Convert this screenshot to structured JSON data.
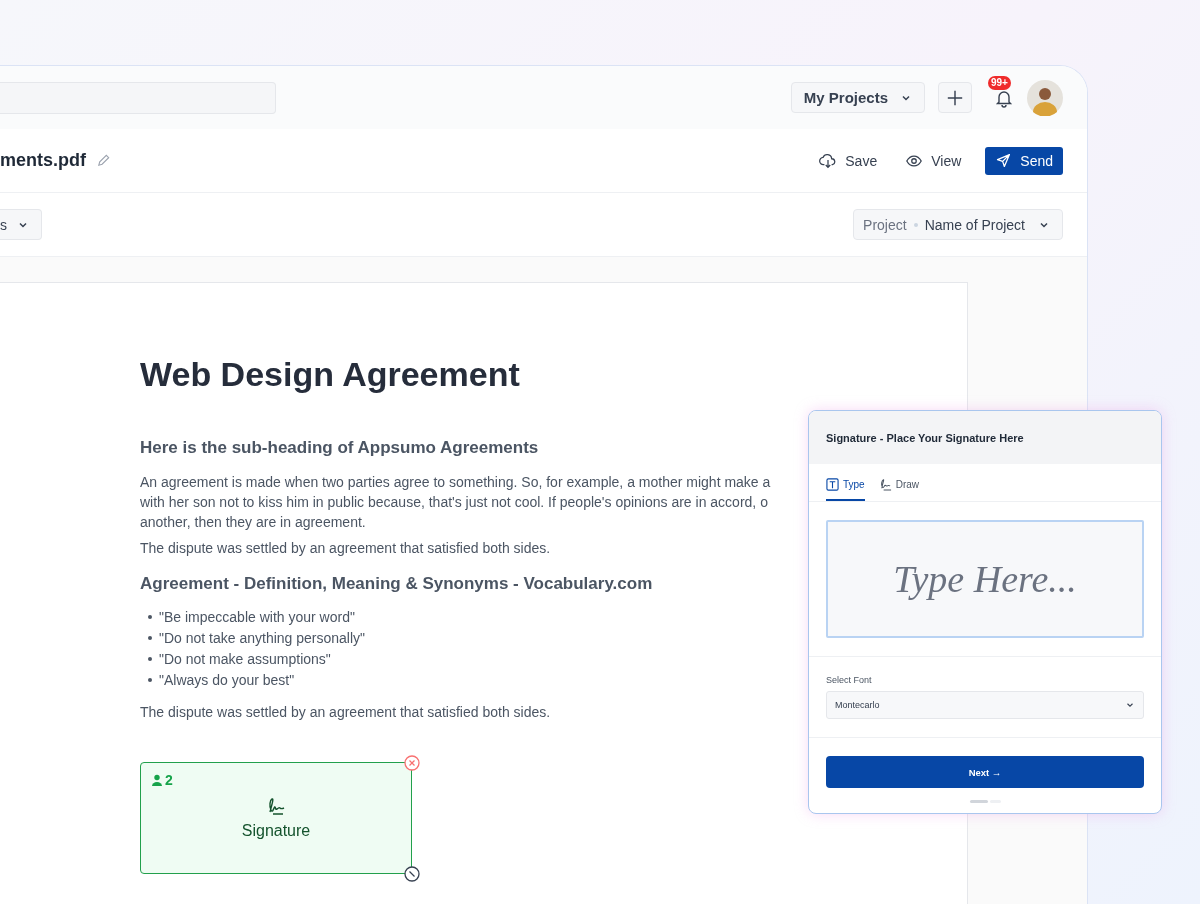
{
  "header": {
    "project_menu": "My Projects",
    "notification_badge": "99+"
  },
  "toolbar": {
    "file_name": "ments.pdf",
    "actions": [
      {
        "label": "Save",
        "kind": "save"
      },
      {
        "label": "View",
        "kind": "view"
      },
      {
        "label": "Send",
        "kind": "send"
      }
    ]
  },
  "filter_bar": {
    "left_dropdown": "s",
    "project_label": "Project",
    "project_value": "Name of Project"
  },
  "document": {
    "title": "Web Design Agreement",
    "subheading": "Here is the sub-heading of Appsumo Agreements",
    "paragraph_lines": [
      "An agreement is made when two parties agree to something. So, for example, a mother might make a",
      "with her son not to kiss him in public because, that's just not cool. If people's opinions are in accord, o",
      "another, then they are in agreement."
    ],
    "sentence": "The dispute was settled by an agreement that satisfied both sides.",
    "heading_2": "Agreement - Definition, Meaning & Synonyms - Vocabulary.com",
    "bullets": [
      "\"Be impeccable with your word\"",
      "\"Do not take anything personally\"",
      "\"Do not make assumptions\"",
      "\"Always do your best\""
    ],
    "closing": "The dispute was settled by an agreement that satisfied both sides.",
    "signature_field": {
      "signer": "2",
      "label": "Signature"
    }
  },
  "signature_dialog": {
    "title": "Signature - Place Your Signature Here",
    "tabs": [
      {
        "label": "Type",
        "kind": "type",
        "selected": true
      },
      {
        "label": "Draw",
        "kind": "draw",
        "selected": false
      }
    ],
    "placeholder": "Type Here...",
    "font_label": "Select Font",
    "font_value": "Montecarlo",
    "next_button": "Next →"
  }
}
